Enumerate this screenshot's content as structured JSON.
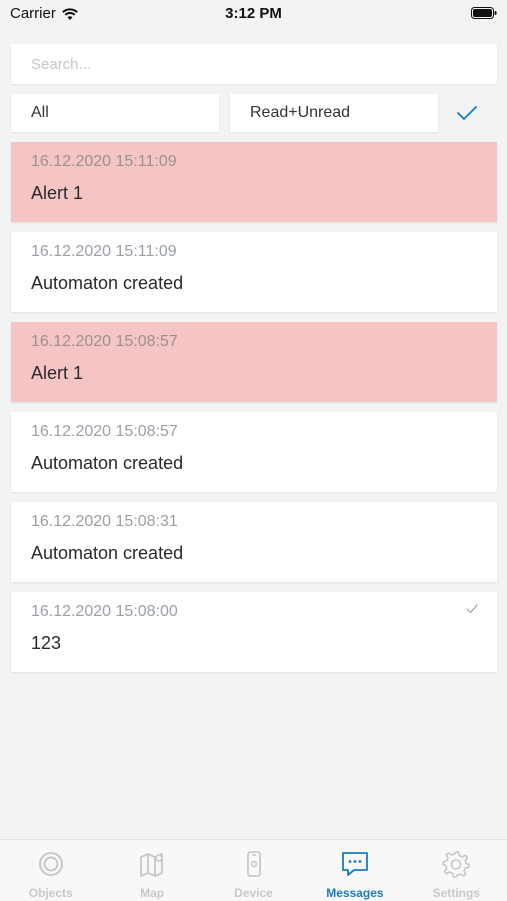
{
  "status_bar": {
    "carrier": "Carrier",
    "time": "3:12 PM"
  },
  "search": {
    "placeholder": "Search..."
  },
  "filters": {
    "type": "All",
    "read_state": "Read+Unread"
  },
  "messages": [
    {
      "time": "16.12.2020 15:11:09",
      "text": "Alert 1",
      "alert": true,
      "read": false
    },
    {
      "time": "16.12.2020 15:11:09",
      "text": "Automaton created",
      "alert": false,
      "read": false
    },
    {
      "time": "16.12.2020 15:08:57",
      "text": "Alert 1",
      "alert": true,
      "read": false
    },
    {
      "time": "16.12.2020 15:08:57",
      "text": "Automaton created",
      "alert": false,
      "read": false
    },
    {
      "time": "16.12.2020 15:08:31",
      "text": "Automaton created",
      "alert": false,
      "read": false
    },
    {
      "time": "16.12.2020 15:08:00",
      "text": "123",
      "alert": false,
      "read": true
    }
  ],
  "tabs": [
    {
      "label": "Objects",
      "icon": "objects-icon",
      "active": false
    },
    {
      "label": "Map",
      "icon": "map-icon",
      "active": false
    },
    {
      "label": "Device",
      "icon": "device-icon",
      "active": false
    },
    {
      "label": "Messages",
      "icon": "messages-icon",
      "active": true
    },
    {
      "label": "Settings",
      "icon": "settings-icon",
      "active": false
    }
  ],
  "colors": {
    "accent": "#1a7cb6",
    "alert_bg": "#f5c4c4",
    "inactive_tab": "#c6c8cc",
    "background": "#f2f3f5"
  }
}
